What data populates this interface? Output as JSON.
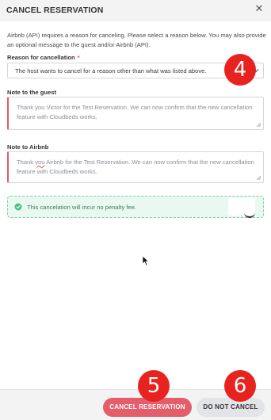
{
  "modal": {
    "title": "CANCEL RESERVATION",
    "close_glyph": "✕"
  },
  "intro_text": "Airbnb (API) requires a reason for canceling. Please select a reason below. You may also provide an optional message to the guest and/or Airbnb (API).",
  "reason": {
    "label": "Reason for cancellation",
    "required_marker": "*",
    "selected": "The host wants to cancel for a reason other than what was listed above."
  },
  "note_guest": {
    "label": "Note to the guest",
    "text": "Thank you Victor for the Test Reservation. We can now confirm that the new cancellation feature with Cloudbeds works."
  },
  "note_airbnb": {
    "label": "Note to Airbnb",
    "text_before": "Thank ",
    "text_misspelled": "you",
    "text_after": " Airbnb for the Test Reservation. We can now confirm that the new cancellation feature with Cloudbeds works."
  },
  "alert": {
    "message": "This cancelation will incur no penalty fee."
  },
  "footer": {
    "cancel_button": "CANCEL RESERVATION",
    "keep_button": "DO NOT CANCEL"
  },
  "callouts": {
    "reason_badge": "4",
    "cancel_badge": "5",
    "keep_badge": "6"
  },
  "colors": {
    "accent_red": "#e35d6a",
    "success_green": "#3d7d5c",
    "callout_red": "#e8231f"
  }
}
